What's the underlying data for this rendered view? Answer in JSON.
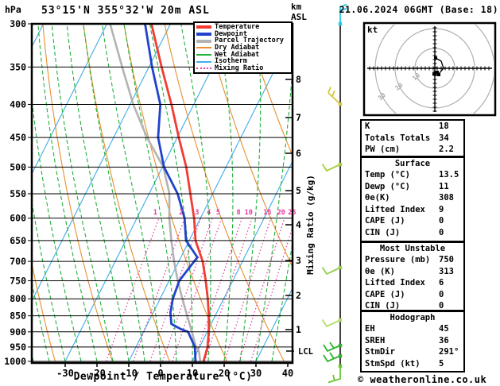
{
  "header": {
    "pressure_unit": "hPa",
    "title": "53°15'N 355°32'W 20m ASL",
    "alt_unit_line1": "km",
    "alt_unit_line2": "ASL",
    "datetime": "21.06.2024 06GMT (Base: 18)"
  },
  "legend": {
    "items": [
      {
        "label": "Temperature",
        "color": "#f23b32",
        "weight": "thick"
      },
      {
        "label": "Dewpoint",
        "color": "#2143cc",
        "weight": "thick"
      },
      {
        "label": "Parcel Trajectory",
        "color": "#b3b3b3",
        "weight": "thick"
      },
      {
        "label": "Dry Adiabat",
        "color": "#e5912e",
        "weight": "thin"
      },
      {
        "label": "Wet Adiabat",
        "color": "#21b13a",
        "weight": "thin"
      },
      {
        "label": "Isotherm",
        "color": "#41aee8",
        "weight": "thin"
      },
      {
        "label": "Mixing Ratio",
        "color": "#e7359e",
        "weight": "dotted"
      }
    ]
  },
  "axes": {
    "x_label": "Dewpoint / Temperature (°C)",
    "mixing_axis_label": "Mixing Ratio (g/kg)",
    "lcl_label": "LCL"
  },
  "chart_data": {
    "type": "line",
    "title": "Skew-T log-P sounding 53°15'N 355°32'W 20m ASL 21.06.2024 06GMT",
    "x_axis": {
      "label": "Dewpoint / Temperature (°C)",
      "ticks": [
        -30,
        -20,
        -10,
        0,
        10,
        20,
        30,
        40
      ],
      "range": [
        -40,
        40
      ]
    },
    "y_axis": {
      "label": "hPa",
      "scale": "log",
      "levels": [
        300,
        350,
        400,
        450,
        500,
        550,
        600,
        650,
        700,
        750,
        800,
        850,
        900,
        950,
        1000
      ]
    },
    "km_ticks": [
      [
        8,
        100
      ],
      [
        7,
        148
      ],
      [
        6,
        193
      ],
      [
        5,
        240
      ],
      [
        4,
        283
      ],
      [
        3,
        328
      ],
      [
        2,
        372
      ],
      [
        1,
        415
      ]
    ],
    "lcl_y": 442,
    "mixing_ratio_values_g_kg": [
      1,
      2,
      3,
      4,
      5,
      8,
      10,
      15,
      20,
      25
    ],
    "isotherm_step_c": 20,
    "series": [
      {
        "name": "Temperature",
        "color": "#f23b32",
        "points": [
          [
            1000,
            13.5
          ],
          [
            950,
            12.5
          ],
          [
            900,
            10.5
          ],
          [
            850,
            8
          ],
          [
            800,
            5
          ],
          [
            750,
            1.5
          ],
          [
            700,
            -2.5
          ],
          [
            650,
            -8
          ],
          [
            600,
            -12
          ],
          [
            550,
            -17
          ],
          [
            500,
            -22.5
          ],
          [
            450,
            -29.5
          ],
          [
            400,
            -37
          ],
          [
            350,
            -46
          ],
          [
            300,
            -56
          ]
        ]
      },
      {
        "name": "Dewpoint",
        "color": "#2143cc",
        "points": [
          [
            1000,
            11
          ],
          [
            950,
            8.5
          ],
          [
            900,
            4
          ],
          [
            890,
            1
          ],
          [
            875,
            -2.5
          ],
          [
            840,
            -4.6
          ],
          [
            800,
            -6
          ],
          [
            750,
            -6.8
          ],
          [
            710,
            -5.5
          ],
          [
            690,
            -4.8
          ],
          [
            650,
            -11
          ],
          [
            600,
            -15
          ],
          [
            550,
            -21
          ],
          [
            500,
            -29.5
          ],
          [
            450,
            -36
          ],
          [
            400,
            -40.5
          ],
          [
            350,
            -49
          ],
          [
            300,
            -58
          ]
        ]
      },
      {
        "name": "Parcel Trajectory",
        "color": "#b3b3b3",
        "points": [
          [
            1000,
            12.5
          ],
          [
            965,
            10.5
          ],
          [
            950,
            8.9
          ],
          [
            900,
            5.2
          ],
          [
            850,
            1.2
          ],
          [
            800,
            -3
          ],
          [
            750,
            -7.3
          ],
          [
            700,
            -11.5
          ],
          [
            650,
            -15.6
          ],
          [
            600,
            -19.8
          ],
          [
            550,
            -23.6
          ],
          [
            500,
            -29.7
          ],
          [
            450,
            -39.5
          ],
          [
            400,
            -49
          ],
          [
            350,
            -58.4
          ],
          [
            300,
            -69
          ]
        ]
      }
    ]
  },
  "wind_barbs": [
    {
      "y": 30,
      "color": "#2cc8e6",
      "shape": "up"
    },
    {
      "y": 131,
      "color": "#d6c63e",
      "shape": "flag2"
    },
    {
      "y": 207,
      "color": "#a9ce3b",
      "shape": "check"
    },
    {
      "y": 337,
      "color": "#93d14b",
      "shape": "check"
    },
    {
      "y": 403,
      "color": "#b5dc68",
      "shape": "check"
    },
    {
      "y": 435,
      "color": "#2db32d",
      "shape": "check2"
    },
    {
      "y": 448,
      "color": "#2db32d",
      "shape": "check2"
    },
    {
      "y": 461,
      "color": "#69c934",
      "shape": "hook"
    }
  ],
  "hodograph": {
    "unit": "kt",
    "ring_values_kt": [
      10,
      20,
      30
    ],
    "trace_uv_kt": [
      [
        0.4,
        5.2
      ],
      [
        3.2,
        3.6
      ],
      [
        4.4,
        0
      ],
      [
        2,
        -2.8
      ],
      [
        0,
        -2
      ],
      [
        0.8,
        -3.6
      ],
      [
        1.6,
        -2.4
      ]
    ],
    "marker_uv_kt": [
      [
        0.4,
        5.2
      ],
      [
        1.2,
        -2
      ],
      [
        2,
        -3.2
      ],
      [
        -0.4,
        -2.8
      ]
    ]
  },
  "stats": {
    "sections": [
      {
        "title": "",
        "rows": [
          [
            "K",
            "18"
          ],
          [
            "Totals Totals",
            "34"
          ],
          [
            "PW (cm)",
            "2.2"
          ]
        ]
      },
      {
        "title": "Surface",
        "rows": [
          [
            "Temp (°C)",
            "13.5"
          ],
          [
            "Dewp (°C)",
            "11"
          ],
          [
            "θe(K)",
            "308"
          ],
          [
            "Lifted Index",
            "9"
          ],
          [
            "CAPE (J)",
            "0"
          ],
          [
            "CIN (J)",
            "0"
          ]
        ]
      },
      {
        "title": "Most Unstable",
        "rows": [
          [
            "Pressure (mb)",
            "750"
          ],
          [
            "θe (K)",
            "313"
          ],
          [
            "Lifted Index",
            "6"
          ],
          [
            "CAPE (J)",
            "0"
          ],
          [
            "CIN (J)",
            "0"
          ]
        ]
      },
      {
        "title": "Hodograph",
        "rows": [
          [
            "EH",
            "45"
          ],
          [
            "SREH",
            "36"
          ],
          [
            "StmDir",
            "291°"
          ],
          [
            "StmSpd (kt)",
            "5"
          ]
        ]
      }
    ]
  },
  "footer": {
    "credit": "© weatheronline.co.uk"
  }
}
